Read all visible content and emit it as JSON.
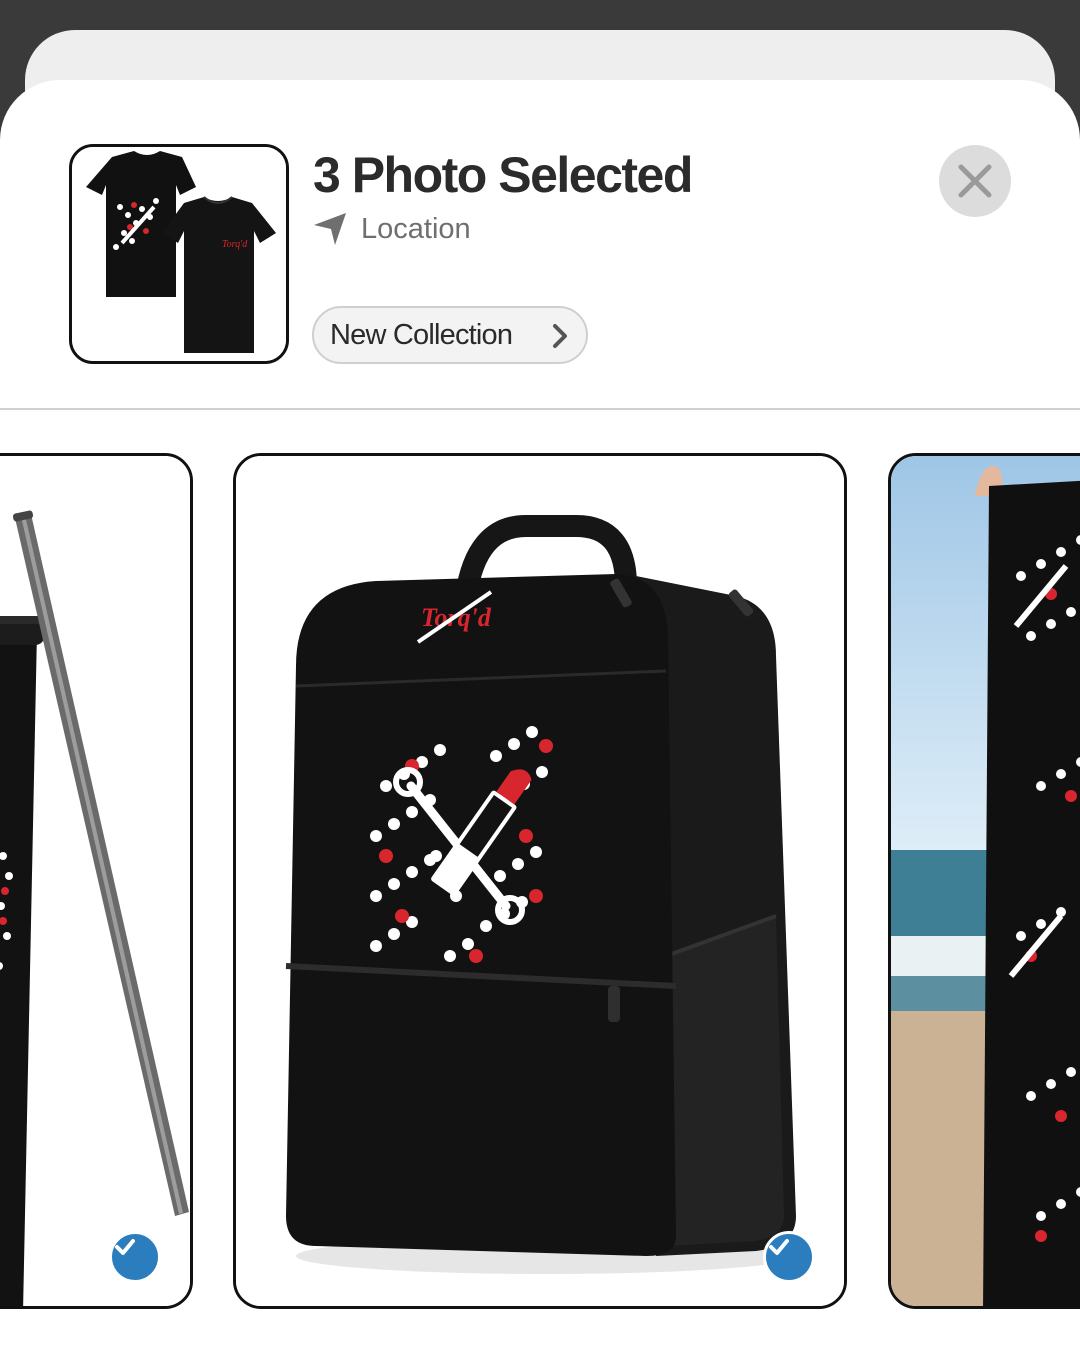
{
  "header": {
    "title": "3 Photo Selected",
    "location_label": "Location",
    "collection_label": "New Collection"
  },
  "icons": {
    "location": "navigation-arrow-icon",
    "close": "close-x-icon",
    "chevron": "chevron-right-icon",
    "check": "checkmark-icon"
  },
  "photos": [
    {
      "name": "tumbler with straw",
      "selected": true
    },
    {
      "name": "backpack",
      "selected": true,
      "brand_text": "Torq'd"
    },
    {
      "name": "beach towel",
      "selected": false
    }
  ],
  "colors": {
    "check": "#2b7dbd",
    "accent_red": "#d7262e",
    "product_black": "#111111"
  }
}
